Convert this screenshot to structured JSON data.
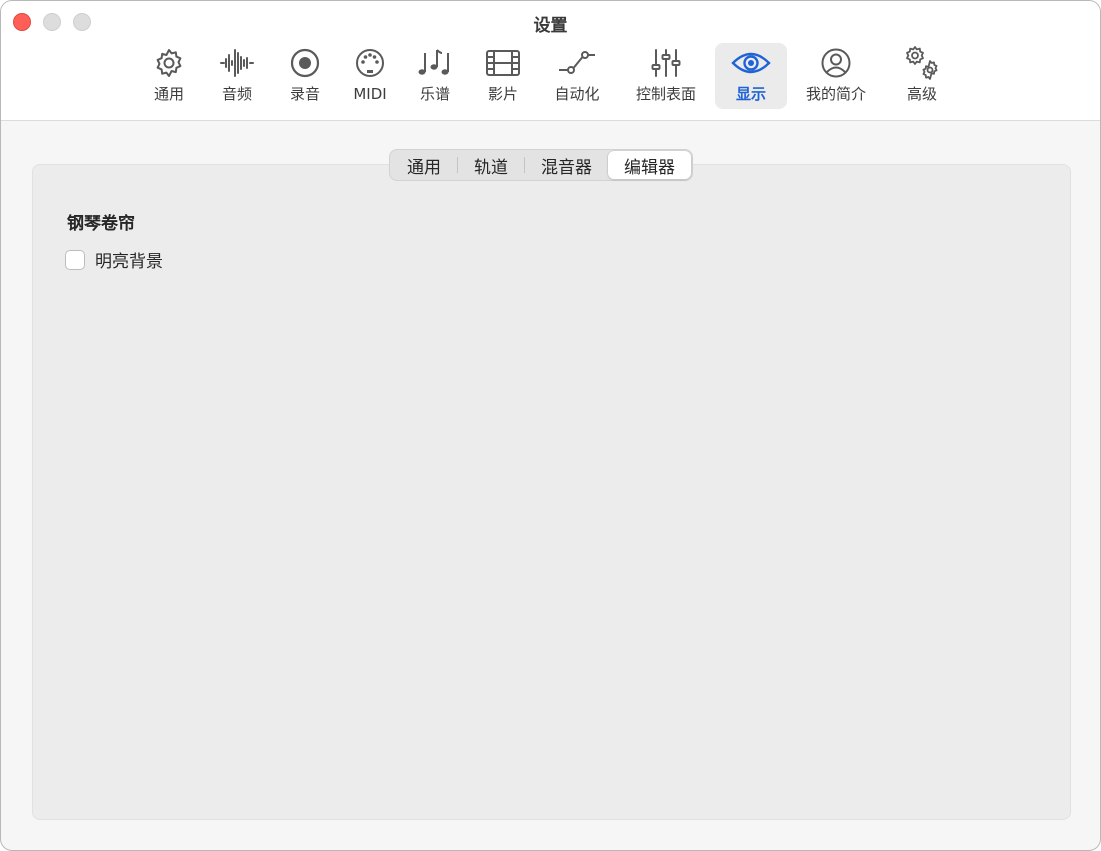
{
  "window": {
    "title": "设置"
  },
  "toolbar": {
    "items": [
      {
        "label": "通用",
        "icon": "gear-icon"
      },
      {
        "label": "音频",
        "icon": "waveform-icon"
      },
      {
        "label": "录音",
        "icon": "record-icon"
      },
      {
        "label": "MIDI",
        "icon": "midi-port-icon"
      },
      {
        "label": "乐谱",
        "icon": "music-notes-icon"
      },
      {
        "label": "影片",
        "icon": "film-icon"
      },
      {
        "label": "自动化",
        "icon": "automation-curve-icon"
      },
      {
        "label": "控制表面",
        "icon": "sliders-icon"
      },
      {
        "label": "显示",
        "icon": "eye-icon"
      },
      {
        "label": "我的简介",
        "icon": "person-circle-icon"
      },
      {
        "label": "高级",
        "icon": "gears-icon"
      }
    ],
    "active": "显示"
  },
  "tabs": {
    "items": [
      "通用",
      "轨道",
      "混音器",
      "编辑器"
    ],
    "selected": "编辑器"
  },
  "editor": {
    "section_title": "钢琴卷帘",
    "bright_background": {
      "label": "明亮背景",
      "checked": false
    }
  },
  "colors": {
    "accent": "#1f63d6",
    "close": "#ff5f57",
    "window_bg": "#f6f6f6",
    "panel_bg": "#ececec"
  }
}
